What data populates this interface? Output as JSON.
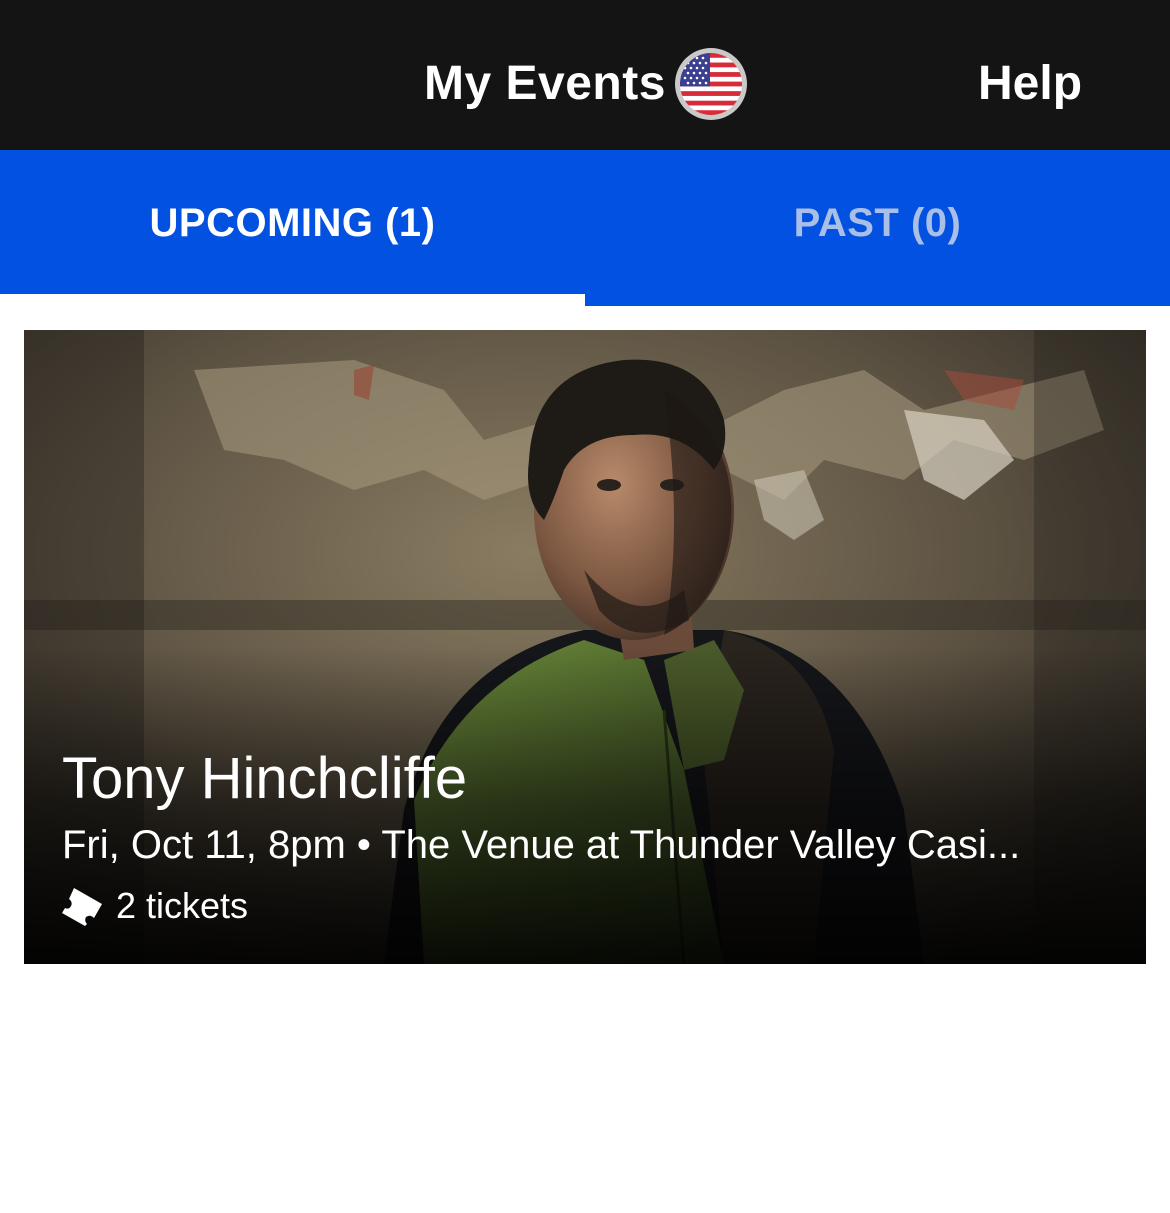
{
  "header": {
    "title": "My Events",
    "help_label": "Help",
    "region_icon": "us-flag-icon"
  },
  "tabs": [
    {
      "label": "UPCOMING (1)",
      "active": true
    },
    {
      "label": "PAST (0)",
      "active": false
    }
  ],
  "colors": {
    "header_bg": "#141414",
    "tab_bar_bg": "#0251e1",
    "tab_active_text": "#ffffff",
    "tab_inactive_text": "#a9bfe8"
  },
  "events": [
    {
      "name": "Tony Hinchcliffe",
      "date_time": "Fri, Oct 11, 8pm",
      "separator": "•",
      "venue": "The Venue at Thunder Valley Casi...",
      "tickets_label": "2 tickets",
      "ticket_icon": "ticket-icon"
    }
  ]
}
